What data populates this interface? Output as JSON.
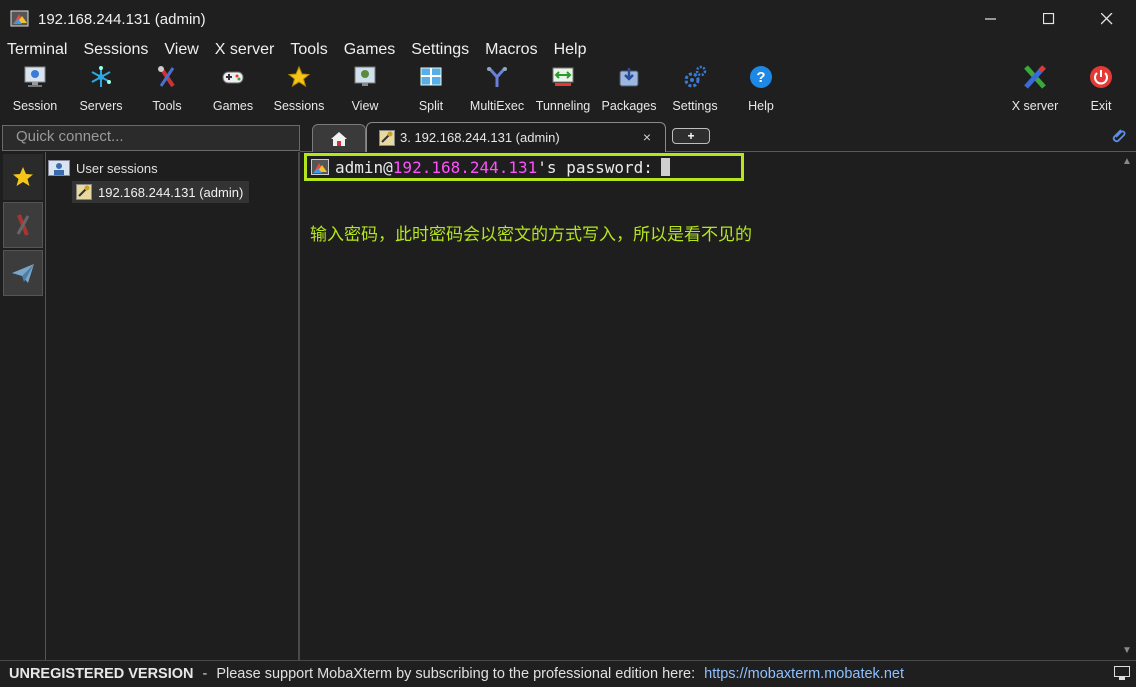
{
  "window": {
    "title": "192.168.244.131 (admin)",
    "controls": [
      "minimize-icon",
      "maximize-icon",
      "close-icon"
    ]
  },
  "menu": [
    "Terminal",
    "Sessions",
    "View",
    "X server",
    "Tools",
    "Games",
    "Settings",
    "Macros",
    "Help"
  ],
  "toolbar": {
    "left": [
      {
        "label": "Session",
        "icon": "session-icon"
      },
      {
        "label": "Servers",
        "icon": "servers-icon"
      },
      {
        "label": "Tools",
        "icon": "tools-icon"
      },
      {
        "label": "Games",
        "icon": "games-icon"
      },
      {
        "label": "Sessions",
        "icon": "sessions-star-icon"
      },
      {
        "label": "View",
        "icon": "view-icon"
      },
      {
        "label": "Split",
        "icon": "split-icon"
      },
      {
        "label": "MultiExec",
        "icon": "multiexec-icon"
      },
      {
        "label": "Tunneling",
        "icon": "tunneling-icon"
      },
      {
        "label": "Packages",
        "icon": "packages-icon"
      },
      {
        "label": "Settings",
        "icon": "settings-gears-icon"
      },
      {
        "label": "Help",
        "icon": "help-icon"
      }
    ],
    "right": [
      {
        "label": "X server",
        "icon": "xserver-icon"
      },
      {
        "label": "Exit",
        "icon": "exit-icon"
      }
    ]
  },
  "quick_connect": {
    "placeholder": "Quick connect..."
  },
  "tabs": {
    "home_icon": "home-icon",
    "active": {
      "label": "3. 192.168.244.131 (admin)",
      "icon": "ssh-key-icon",
      "close": "×"
    },
    "new_tab": "+"
  },
  "sidebar": {
    "rail": [
      "star-icon",
      "tools-rail-icon",
      "send-icon"
    ],
    "tree": {
      "root_label": "User sessions",
      "items": [
        {
          "label": "192.168.244.131 (admin)",
          "icon": "ssh-key-icon"
        }
      ]
    }
  },
  "terminal": {
    "prompt_user": "admin@",
    "prompt_host": "192.168.244.131",
    "prompt_rest": "'s password:",
    "annotation": "输入密码，此时密码会以密文的方式写入，所以是看不见的"
  },
  "status": {
    "version": "UNREGISTERED VERSION",
    "separator": "-",
    "message": "Please support MobaXterm by subscribing to the professional edition here:",
    "link": "https://mobaxterm.mobatek.net"
  },
  "colors": {
    "highlight": "#b5e61d",
    "host": "#ff4fff",
    "link": "#8fc0ff"
  }
}
